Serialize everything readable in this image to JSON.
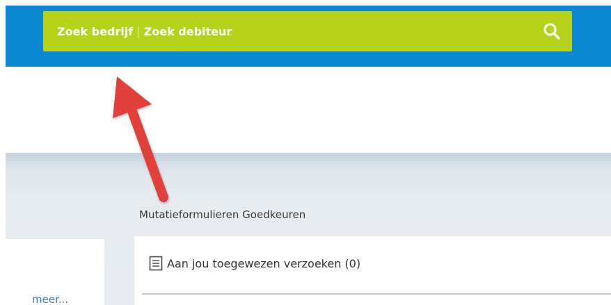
{
  "search": {
    "company_label": "Zoek bedrijf",
    "separator": "|",
    "debtor_label": "Zoek debiteur"
  },
  "section": {
    "title": "Mutatieformulieren Goedkeuren",
    "request_label": "Aan jou toegewezen verzoeken (0)"
  },
  "left_panel": {
    "more_link": "meer..."
  },
  "colors": {
    "header": "#0a88d2",
    "search_bar": "#b6d21a",
    "annotation_arrow": "#e0433a"
  },
  "icons": {
    "search": "search-icon",
    "request": "document-list-icon",
    "annotation": "red-arrow-annotation"
  }
}
